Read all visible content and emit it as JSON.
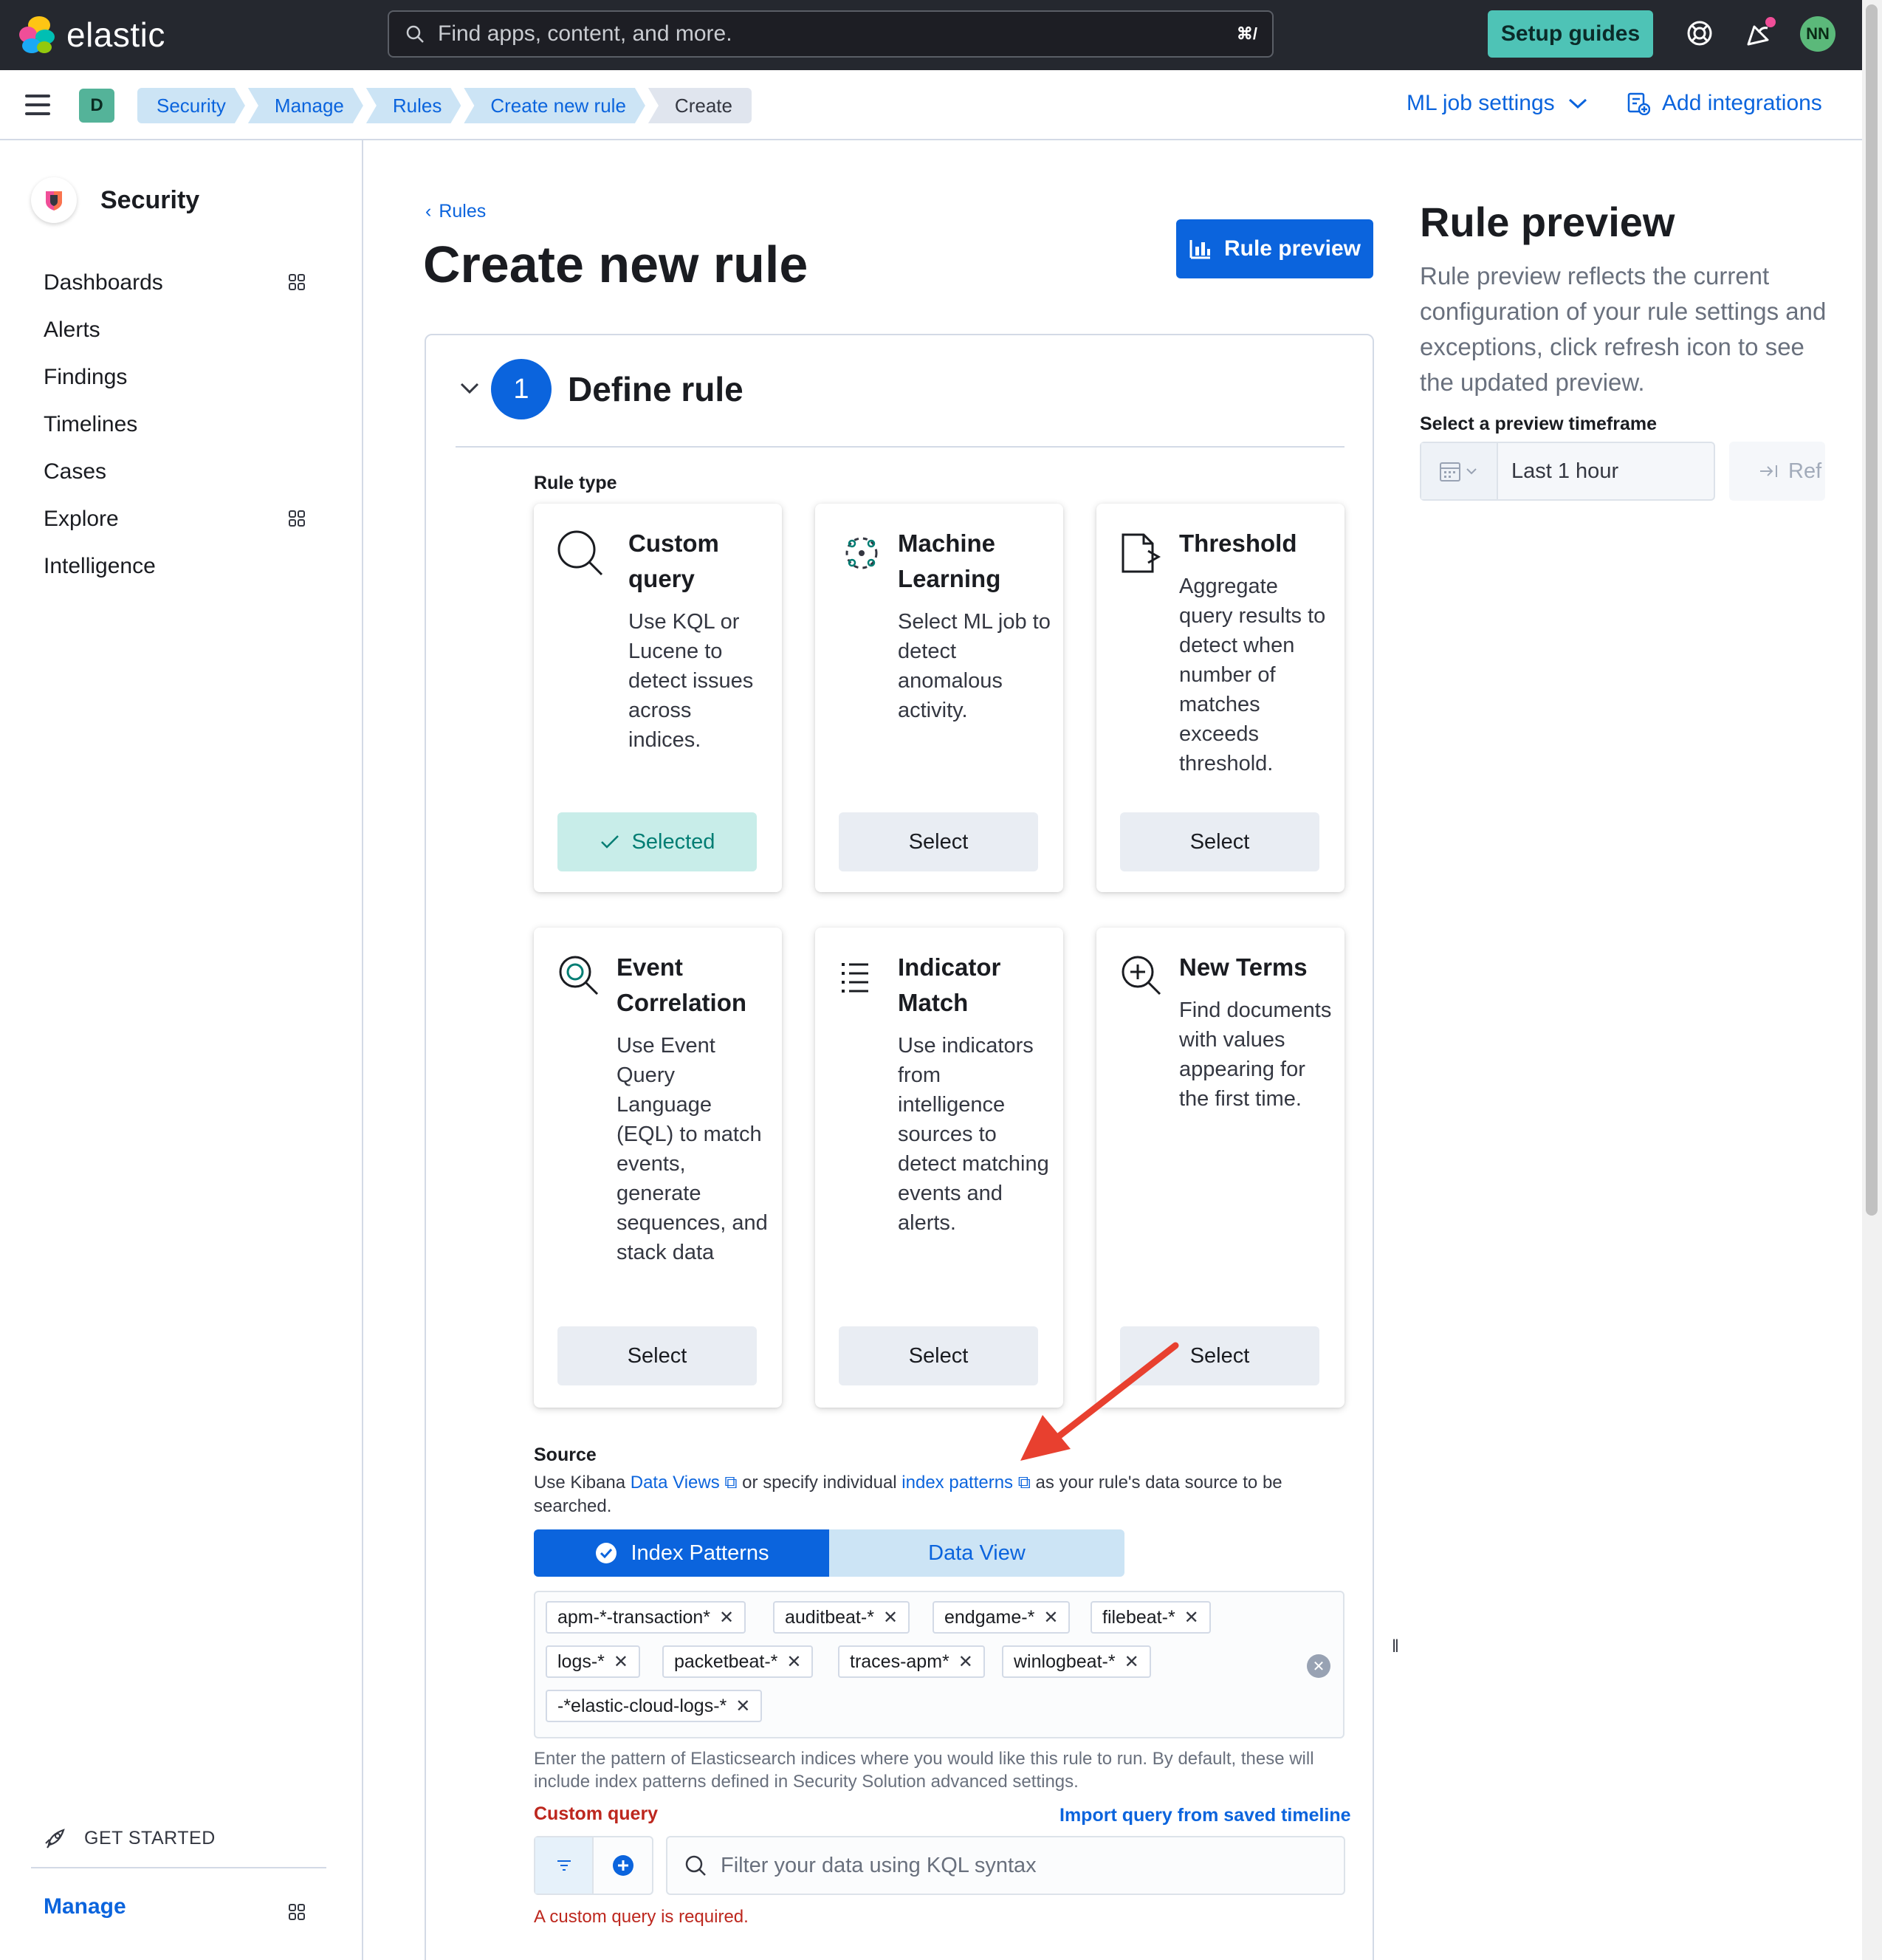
{
  "header": {
    "brand": "elastic",
    "search_placeholder": "Find apps, content, and more.",
    "search_shortcut": "⌘/",
    "setup_guides": "Setup guides",
    "avatar_initials": "NN"
  },
  "breadcrumbs": {
    "space": "D",
    "items": [
      "Security",
      "Manage",
      "Rules",
      "Create new rule",
      "Create"
    ],
    "ml_job_settings": "ML job settings",
    "add_integrations": "Add integrations"
  },
  "sidebar": {
    "title": "Security",
    "items": [
      "Dashboards",
      "Alerts",
      "Findings",
      "Timelines",
      "Cases",
      "Explore",
      "Intelligence"
    ],
    "get_started": "GET STARTED",
    "manage": "Manage"
  },
  "main": {
    "back_link": "Rules",
    "title": "Create new rule",
    "preview_button": "Rule preview",
    "step": {
      "number": "1",
      "title": "Define rule"
    },
    "rule_type_label": "Rule type",
    "rule_types": [
      {
        "title": "Custom query",
        "desc": "Use KQL or Lucene to detect issues across indices.",
        "button": "Selected"
      },
      {
        "title": "Machine Learning",
        "desc": "Select ML job to detect anomalous activity.",
        "button": "Select"
      },
      {
        "title": "Threshold",
        "desc": "Aggregate query results to detect when number of matches exceeds threshold.",
        "button": "Select"
      },
      {
        "title": "Event Correlation",
        "desc": "Use Event Query Language (EQL) to match events, generate sequences, and stack data",
        "button": "Select"
      },
      {
        "title": "Indicator Match",
        "desc": "Use indicators from intelligence sources to detect matching events and alerts.",
        "button": "Select"
      },
      {
        "title": "New Terms",
        "desc": "Find documents with values appearing for the first time.",
        "button": "Select"
      }
    ],
    "source": {
      "label": "Source",
      "text_1": "Use Kibana ",
      "link_1": "Data Views",
      "text_2": " or specify individual ",
      "link_2": "index patterns",
      "text_3": " as your rule's data source to be searched.",
      "tab_index_patterns": "Index Patterns",
      "tab_data_view": "Data View",
      "patterns": [
        "apm-*-transaction*",
        "auditbeat-*",
        "endgame-*",
        "filebeat-*",
        "logs-*",
        "packetbeat-*",
        "traces-apm*",
        "winlogbeat-*",
        "-*elastic-cloud-logs-*"
      ],
      "help": "Enter the pattern of Elasticsearch indices where you would like this rule to run. By default, these will include index patterns defined in Security Solution advanced settings."
    },
    "custom_query": {
      "label": "Custom query",
      "import_link": "Import query from saved timeline",
      "placeholder": "Filter your data using KQL syntax",
      "error": "A custom query is required."
    }
  },
  "preview": {
    "title": "Rule preview",
    "description": "Rule preview reflects the current configuration of your rule settings and exceptions, click refresh icon to see the updated preview.",
    "timeframe_label": "Select a preview timeframe",
    "timeframe_value": "Last 1 hour",
    "refresh_label": "Ref"
  },
  "colors": {
    "primary": "#0b64dd",
    "header_bg": "#25282f",
    "setup_btn": "#4ec3b6",
    "selected_bg": "#c8ede9",
    "danger": "#bd271e",
    "annotation_arrow": "#e8402f"
  }
}
